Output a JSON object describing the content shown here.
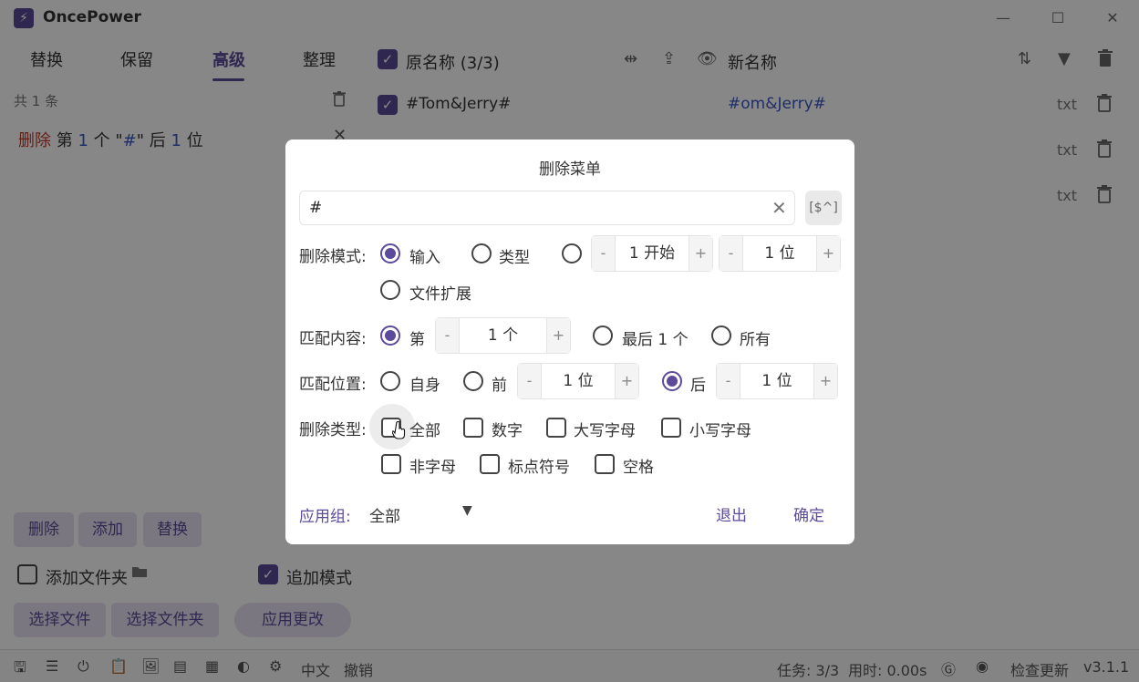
{
  "app": {
    "title": "OncePower",
    "logo_glyph": "⚡"
  },
  "window_controls": {
    "minimize": "—",
    "maximize": "☐",
    "close": "✕"
  },
  "tabs": [
    {
      "label": "替换"
    },
    {
      "label": "保留"
    },
    {
      "label": "高级",
      "active": true
    },
    {
      "label": "整理"
    }
  ],
  "rules": {
    "count_text": "共 1 条",
    "rule": {
      "action": "删除",
      "p1": " 第 ",
      "n": "1",
      "p2": " 个 \"",
      "char": "#",
      "p3": "\" 后 ",
      "n2": "1",
      "p4": " 位"
    }
  },
  "left_actions": {
    "delete": "删除",
    "add": "添加",
    "replace": "替换"
  },
  "left_options": {
    "add_folder": "添加文件夹",
    "append_mode": "追加模式"
  },
  "left_buttons": {
    "select_files": "选择文件",
    "select_folder": "选择文件夹",
    "apply": "应用更改"
  },
  "file_list": {
    "original_header": "原名称 (3/3)",
    "new_header": "新名称",
    "rows": [
      {
        "original": "#Tom&Jerry#",
        "new": "#om&Jerry#",
        "ext": "txt"
      },
      {
        "original": "",
        "new": "",
        "ext": "txt"
      },
      {
        "original": "",
        "new": "",
        "ext": "txt"
      }
    ]
  },
  "status": {
    "language": "中文",
    "undo": "撤销",
    "tasks": "任务: 3/3",
    "time": "用时: 0.00s",
    "check_update": "检查更新",
    "version": "v3.1.1"
  },
  "modal": {
    "title": "删除菜单",
    "search_value": "#",
    "regex_label": "[$^]",
    "delete_mode": {
      "label": "删除模式:",
      "options": {
        "input": "输入",
        "type": "类型",
        "file_ext": "文件扩展"
      },
      "selected": "input",
      "start": "1 开始",
      "length": "1 位"
    },
    "match_content": {
      "label": "匹配内容:",
      "nth_label": "第",
      "nth_value": "1 个",
      "last": "最后 1 个",
      "all": "所有",
      "selected": "nth"
    },
    "match_position": {
      "label": "匹配位置:",
      "self": "自身",
      "before": "前",
      "before_value": "1 位",
      "after": "后",
      "after_value": "1 位",
      "selected": "after"
    },
    "delete_types": {
      "label": "删除类型:",
      "all": "全部",
      "digits": "数字",
      "uppercase": "大写字母",
      "lowercase": "小写字母",
      "non_letters": "非字母",
      "punctuation": "标点符号",
      "space": "空格"
    },
    "apply_group": {
      "label": "应用组:",
      "value": "全部"
    },
    "exit": "退出",
    "confirm": "确定"
  },
  "stepper": {
    "minus": "-",
    "plus": "+"
  },
  "colors": {
    "accent": "#5c4a9a",
    "link_blue": "#3a57c4",
    "danger": "#c0392b"
  }
}
